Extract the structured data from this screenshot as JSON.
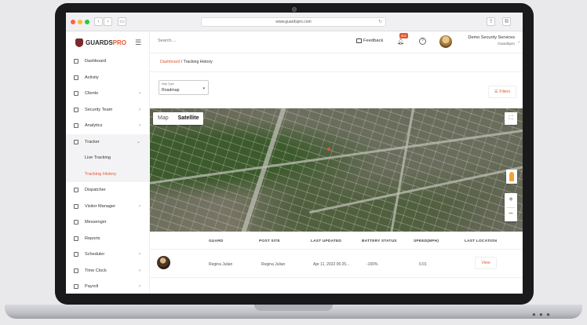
{
  "browser": {
    "url": "www.guardspro.com"
  },
  "brand": {
    "name_part1": "GUARDS",
    "name_part2": "PRO"
  },
  "sidebar": {
    "items": [
      {
        "label": "Dashboard",
        "icon": "dashboard-icon",
        "chevron": false
      },
      {
        "label": "Activity",
        "icon": "activity-icon",
        "chevron": false
      },
      {
        "label": "Clients",
        "icon": "clients-icon",
        "chevron": true
      },
      {
        "label": "Security Team",
        "icon": "team-icon",
        "chevron": true
      },
      {
        "label": "Analytics",
        "icon": "analytics-icon",
        "chevron": true
      },
      {
        "label": "Tracker",
        "icon": "tracker-icon",
        "chevron": true,
        "open": true
      },
      {
        "label": "Dispatcher",
        "icon": "dispatcher-icon",
        "chevron": false
      },
      {
        "label": "Visitor Manager",
        "icon": "visitor-icon",
        "chevron": true
      },
      {
        "label": "Messenger",
        "icon": "messenger-icon",
        "chevron": false
      },
      {
        "label": "Reports",
        "icon": "reports-icon",
        "chevron": false
      },
      {
        "label": "Scheduler",
        "icon": "scheduler-icon",
        "chevron": true
      },
      {
        "label": "Time Clock",
        "icon": "clock-icon",
        "chevron": true
      },
      {
        "label": "Payroll",
        "icon": "payroll-icon",
        "chevron": true
      }
    ],
    "tracker_sub": [
      {
        "label": "Live Tracking",
        "active": false
      },
      {
        "label": "Tracking History",
        "active": true
      }
    ]
  },
  "topbar": {
    "search_placeholder": "Search....",
    "feedback_label": "Feedback",
    "notifications_count": "502",
    "org_name": "Demo Security Services",
    "org_sub": "Guardspro"
  },
  "breadcrumb": {
    "root": "Dashboard",
    "separator": " / ",
    "current": "Tracking History"
  },
  "controls": {
    "map_type_label": "Map Type",
    "map_type_value": "Roadmap",
    "filters_label": "Filters"
  },
  "map": {
    "toggle_map": "Map",
    "toggle_satellite": "Satellite",
    "selected": "Satellite",
    "zoom_in": "+",
    "zoom_out": "−"
  },
  "table": {
    "headers": [
      "GUARD",
      "POST SITE",
      "LAST UPDATED",
      "BATTERY STATUS",
      "SPEED(MPH)",
      "LAST LOCATION"
    ],
    "rows": [
      {
        "guard": "Regina Julian",
        "post_site": "Regina Julian",
        "last_updated": "Apr 11, 2022 06:25...",
        "battery": "-100%",
        "speed": "0.01",
        "action": "View"
      }
    ]
  },
  "colors": {
    "accent": "#e4572e",
    "sidebar_bg": "#ffffff",
    "text": "#333333"
  }
}
